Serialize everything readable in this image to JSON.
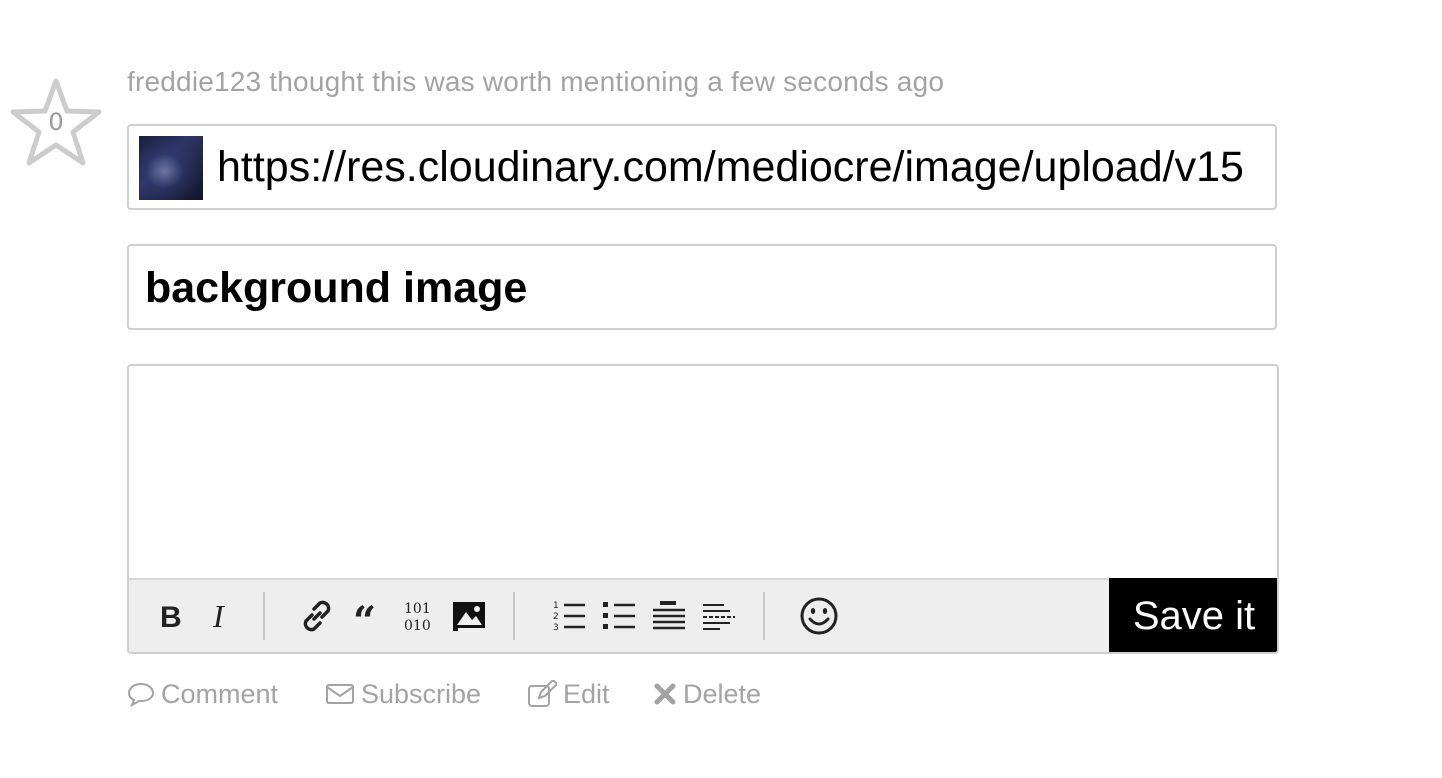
{
  "vote": {
    "count": "0"
  },
  "post": {
    "meta": "freddie123 thought this was worth mentioning a few seconds ago",
    "url_value": "https://res.cloudinary.com/mediocre/image/upload/v15",
    "title_value": "background image",
    "body_value": ""
  },
  "editor": {
    "save_label": "Save it",
    "toolbar": [
      "bold",
      "italic",
      "link",
      "quote",
      "code",
      "image",
      "ordered-list",
      "unordered-list",
      "heading",
      "horizontal-rule",
      "emoji"
    ]
  },
  "actions": {
    "comment": "Comment",
    "subscribe": "Subscribe",
    "edit": "Edit",
    "delete": "Delete"
  },
  "colors": {
    "muted_text": "#a3a3a3",
    "border": "#cfcfcf",
    "toolbar_bg": "#eeeeee",
    "save_bg": "#000000"
  }
}
